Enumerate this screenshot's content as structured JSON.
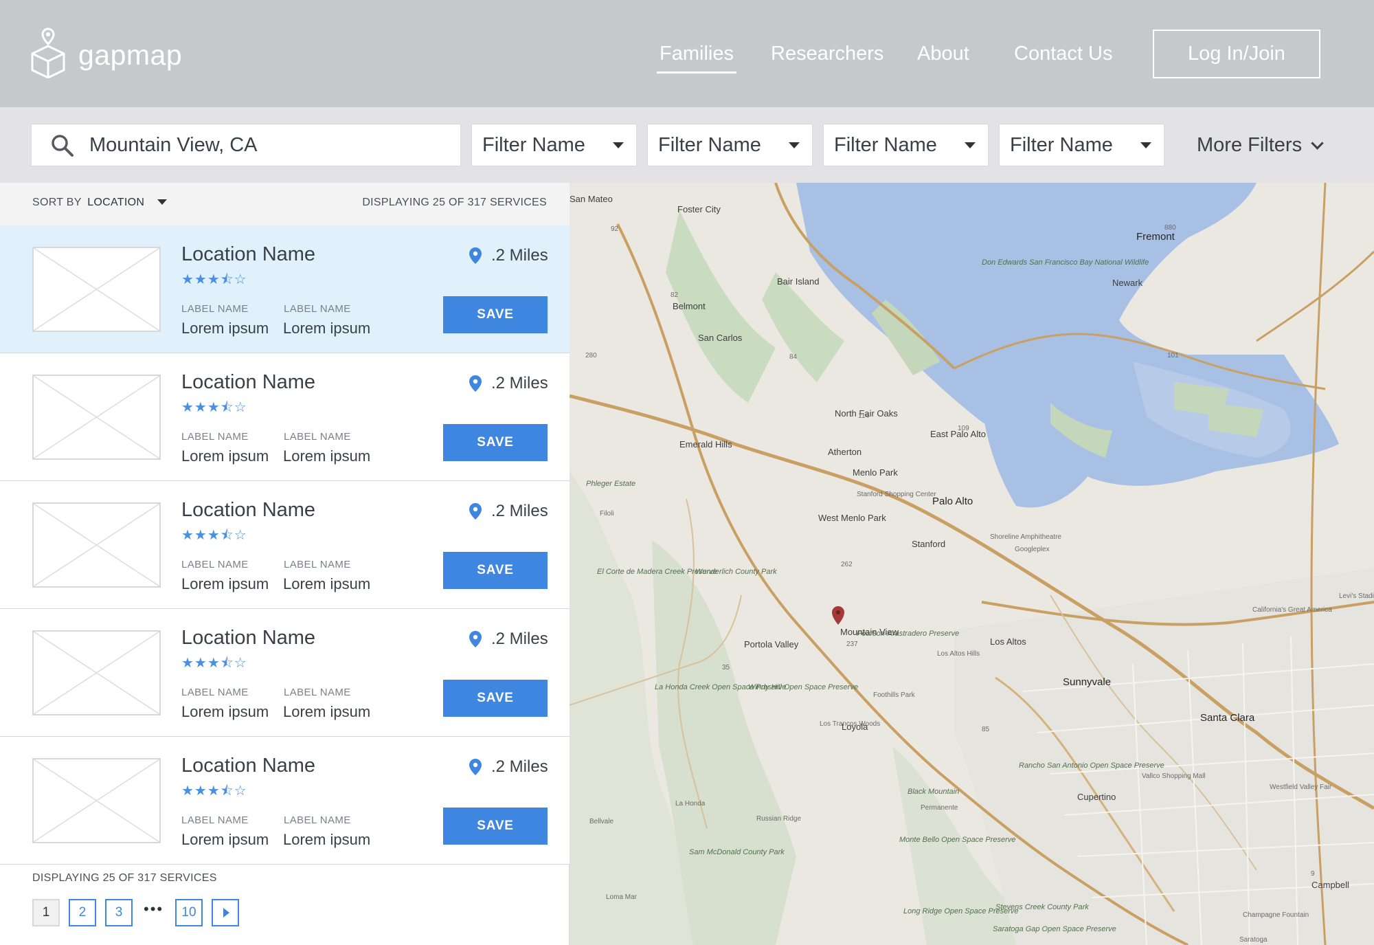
{
  "header": {
    "brand": "gapmap",
    "nav": [
      "Families",
      "Researchers",
      "About",
      "Contact Us"
    ],
    "active_nav": "Families",
    "login_label": "Log In/Join"
  },
  "filters": {
    "search_value": "Mountain View, CA",
    "selects": [
      "Filter Name",
      "Filter Name",
      "Filter Name",
      "Filter Name"
    ],
    "more_label": "More Filters"
  },
  "list": {
    "sort_prefix": "SORT BY",
    "sort_value": "LOCATION",
    "display_top": "DISPLAYING 25 OF 317 SERVICES",
    "display_bottom": "DISPLAYING 25 OF 317 SERVICES",
    "cards": [
      {
        "title": "Location Name",
        "rating": 3.5,
        "stars": "★★★⯪☆",
        "distance": ".2 Miles",
        "label1": "LABEL NAME",
        "value1": "Lorem ipsum",
        "label2": "LABEL NAME",
        "value2": "Lorem ipsum",
        "save_label": "SAVE",
        "selected": true
      },
      {
        "title": "Location Name",
        "rating": 3.5,
        "stars": "★★★⯪☆",
        "distance": ".2 Miles",
        "label1": "LABEL NAME",
        "value1": "Lorem ipsum",
        "label2": "LABEL NAME",
        "value2": "Lorem ipsum",
        "save_label": "SAVE",
        "selected": false
      },
      {
        "title": "Location Name",
        "rating": 3.5,
        "stars": "★★★⯪☆",
        "distance": ".2 Miles",
        "label1": "LABEL NAME",
        "value1": "Lorem ipsum",
        "label2": "LABEL NAME",
        "value2": "Lorem ipsum",
        "save_label": "SAVE",
        "selected": false
      },
      {
        "title": "Location Name",
        "rating": 3.5,
        "stars": "★★★⯪☆",
        "distance": ".2 Miles",
        "label1": "LABEL NAME",
        "value1": "Lorem ipsum",
        "label2": "LABEL NAME",
        "value2": "Lorem ipsum",
        "save_label": "SAVE",
        "selected": false
      },
      {
        "title": "Location Name",
        "rating": 3.5,
        "stars": "★★★⯪☆",
        "distance": ".2 Miles",
        "label1": "LABEL NAME",
        "value1": "Lorem ipsum",
        "label2": "LABEL NAME",
        "value2": "Lorem ipsum",
        "save_label": "SAVE",
        "selected": false
      }
    ],
    "pagination": {
      "pages": [
        "1",
        "2",
        "3"
      ],
      "ellipsis": "•••",
      "last_page": "10",
      "current": "1"
    }
  },
  "map": {
    "places": [
      "San Mateo",
      "Foster City",
      "Fremont",
      "Newark",
      "Bair Island",
      "Belmont",
      "San Carlos",
      "North Fair Oaks",
      "East Palo Alto",
      "Atherton",
      "Menlo Park",
      "Emerald Hills",
      "Palo Alto",
      "Stanford",
      "West Menlo Park",
      "Stanford Shopping Center",
      "Shoreline Amphitheatre",
      "Googleplex",
      "Mountain View",
      "Los Altos",
      "Los Altos Hills",
      "Portola Valley",
      "Sunnyvale",
      "Santa Clara",
      "Loyola",
      "Cupertino",
      "Los Trancos Woods",
      "La Honda",
      "Permanente",
      "Bellvale",
      "Russian Ridge",
      "Loma Mar",
      "Campbell",
      "Filoli",
      "Foothills Park",
      "Vallco Shopping Mall",
      "Westfield Valley Fair",
      "Levi's Stadium",
      "California's Great America",
      "Champagne Fountain",
      "Saratoga"
    ],
    "parks": [
      "Don Edwards San Francisco Bay National Wildlife",
      "Phleger Estate",
      "El Corte de Madera Creek Preserve",
      "Wunderlich County Park",
      "Pearson-Arastradero Preserve",
      "Windy Hill Open Space Preserve",
      "La Honda Creek Open Space Preserve",
      "Rancho San Antonio Open Space Preserve",
      "Black Mountain",
      "Monte Bello Open Space Preserve",
      "Sam McDonald County Park",
      "Long Ridge Open Space Preserve",
      "Saratoga Gap Open Space Preserve",
      "Stevens Creek County Park"
    ],
    "highways": [
      "101",
      "280",
      "84",
      "82",
      "92",
      "35",
      "237",
      "85",
      "880",
      "9",
      "109",
      "114",
      "262"
    ],
    "marker_label": "Mountain View"
  }
}
